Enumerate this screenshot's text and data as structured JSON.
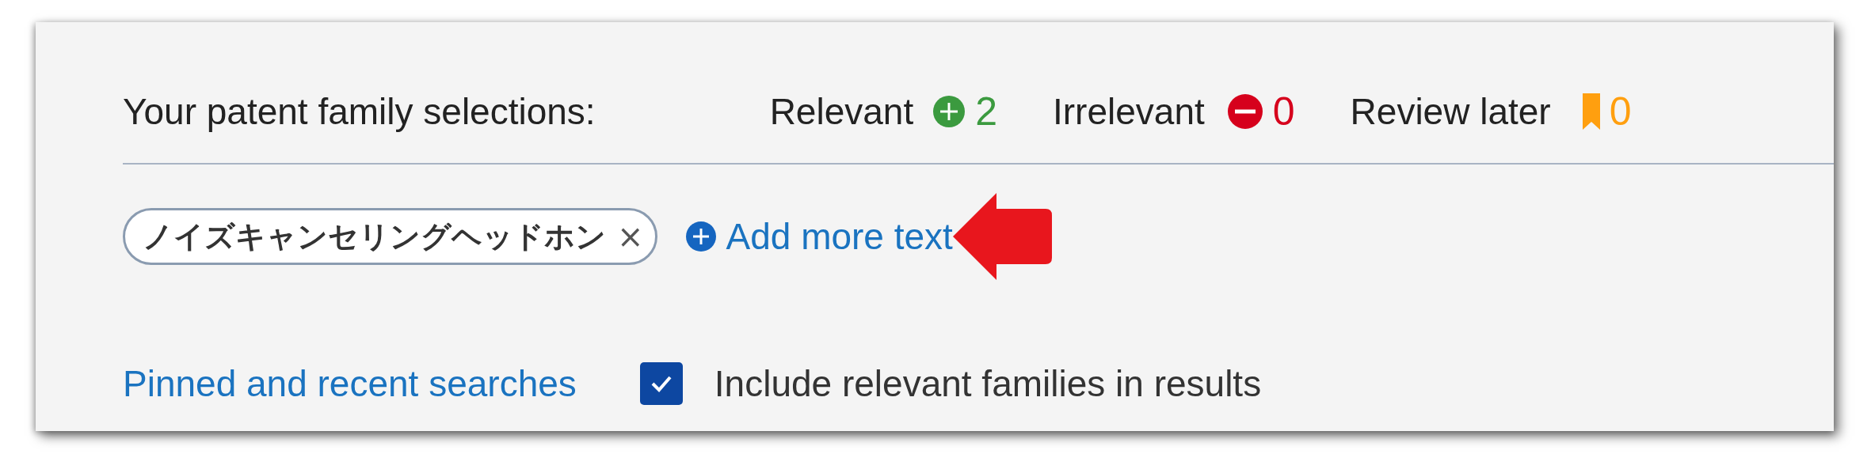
{
  "selections": {
    "label": "Your patent family selections:",
    "counts": [
      {
        "kind": "relevant",
        "label": "Relevant",
        "count": "2",
        "color": "#3b9a3f"
      },
      {
        "kind": "irrelevant",
        "label": "Irrelevant",
        "count": "0",
        "color": "#d6001c"
      },
      {
        "kind": "review",
        "label": "Review later",
        "count": "0",
        "color": "#ff9f0f"
      }
    ]
  },
  "search_terms": [
    {
      "label": "ノイズキャンセリングヘッドホン",
      "remove": "×"
    }
  ],
  "add_link": "Add more text",
  "pinned_link": "Pinned and recent searches",
  "include_checkbox": {
    "label": "Include relevant families in results",
    "checked": true
  }
}
